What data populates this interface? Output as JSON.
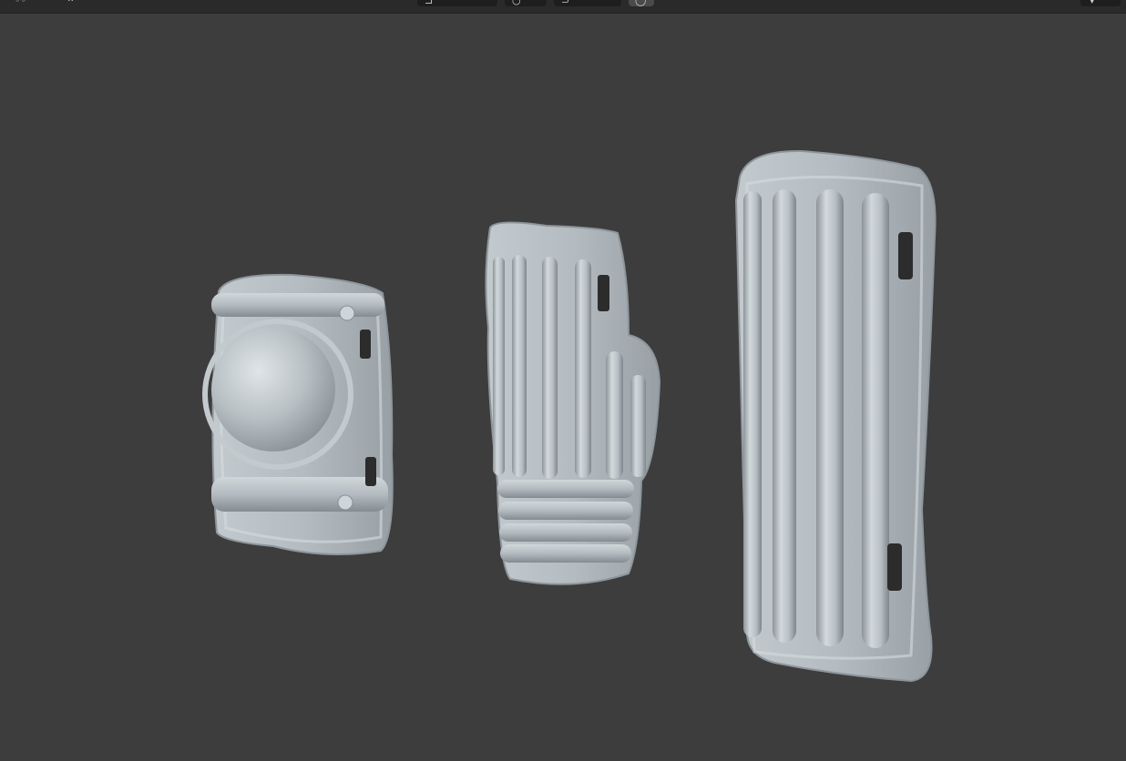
{
  "viewport": {
    "background_color": "#3d3d3d",
    "header": {
      "background_color": "#2a2a2a",
      "left_menu": [
        {
          "icon": "view-menu-icon"
        },
        {
          "icon": "select-menu-icon"
        }
      ],
      "center_tools": [
        {
          "icon": "transform-orientation-icon"
        },
        {
          "icon": "pivot-point-icon"
        },
        {
          "icon": "snap-icon"
        },
        {
          "icon": "proportional-editing-icon"
        }
      ],
      "right_tools": [
        {
          "icon": "overlay-dropdown-icon"
        }
      ]
    },
    "scene": {
      "objects": [
        {
          "name": "elbow-guard",
          "material_color": "#b6bec3"
        },
        {
          "name": "forearm-guard",
          "material_color": "#b6bec3"
        },
        {
          "name": "shin-guard",
          "material_color": "#b6bec3"
        }
      ]
    }
  }
}
